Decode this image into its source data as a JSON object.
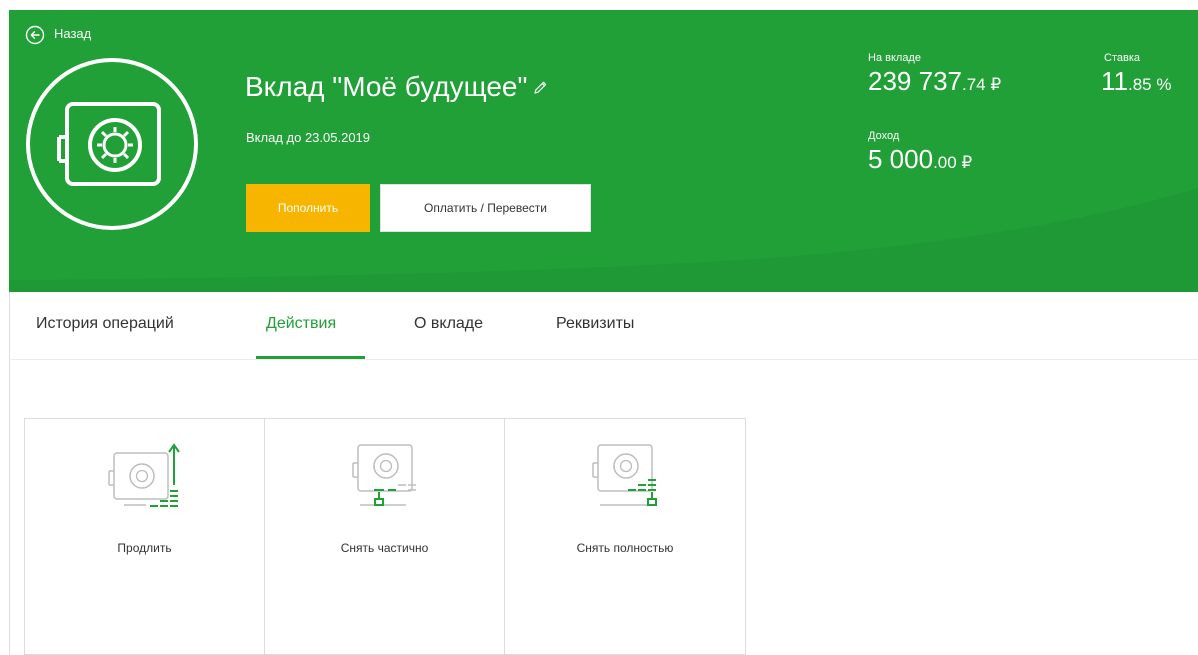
{
  "colors": {
    "brand_green": "#21a038",
    "accent_yellow": "#f7b500"
  },
  "header": {
    "back_label": "Назад",
    "title": "Вклад \"Моё будущее\"",
    "until": "Вклад до 23.05.2019",
    "replenish_label": "Пополнить",
    "pay_label": "Оплатить / Перевести"
  },
  "stats": {
    "balance_label": "На вкладе",
    "balance_int": "239 737",
    "balance_cents": ".74 ₽",
    "rate_label": "Ставка",
    "rate_int": "11",
    "rate_cents": ".85 %",
    "income_label": "Доход",
    "income_int": "5 000",
    "income_cents": ".00 ₽"
  },
  "tabs": [
    {
      "label": "История операций",
      "active": false
    },
    {
      "label": "Действия",
      "active": true
    },
    {
      "label": "О вкладе",
      "active": false
    },
    {
      "label": "Реквизиты",
      "active": false
    }
  ],
  "actions": [
    {
      "label": "Продлить",
      "icon": "safe-extend-icon"
    },
    {
      "label": "Снять частично",
      "icon": "safe-partial-withdraw-icon"
    },
    {
      "label": "Снять полностью",
      "icon": "safe-full-withdraw-icon"
    }
  ]
}
